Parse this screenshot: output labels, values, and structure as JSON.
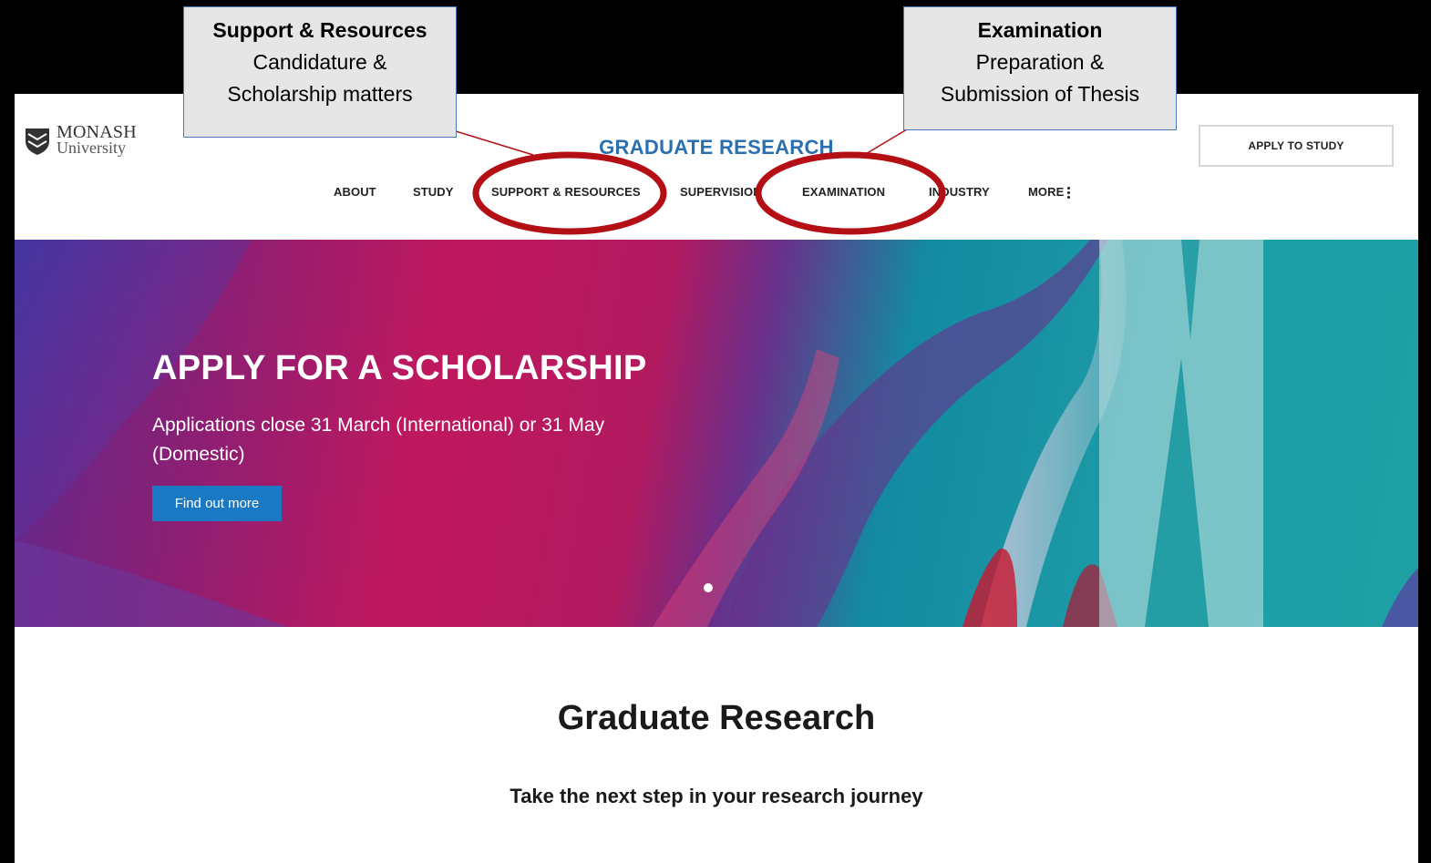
{
  "site": {
    "logo": {
      "line1": "MONASH",
      "line2": "University"
    },
    "title": "GRADUATE RESEARCH",
    "apply_button": "APPLY TO STUDY",
    "nav": [
      "ABOUT",
      "STUDY",
      "SUPPORT & RESOURCES",
      "SUPERVISION",
      "EXAMINATION",
      "INDUSTRY",
      "MORE"
    ],
    "hero": {
      "title": "APPLY FOR A SCHOLARSHIP",
      "subtitle": "Applications close 31 March (International) or 31 May (Domestic)",
      "button": "Find out more"
    },
    "section": {
      "title": "Graduate Research",
      "subtitle": "Take the next step in your research journey"
    }
  },
  "callouts": [
    {
      "title": "Support & Resources",
      "line1": "Candidature &",
      "line2": "Scholarship matters"
    },
    {
      "title": "Examination",
      "line1": "Preparation &",
      "line2": "Submission of Thesis"
    }
  ],
  "colors": {
    "site_title": "#2a6fb0",
    "hero_button": "#1b78c3",
    "highlight_ellipse": "#b30f14",
    "callout_border": "#4d78bd",
    "callout_fill": "#e6e6e6"
  }
}
